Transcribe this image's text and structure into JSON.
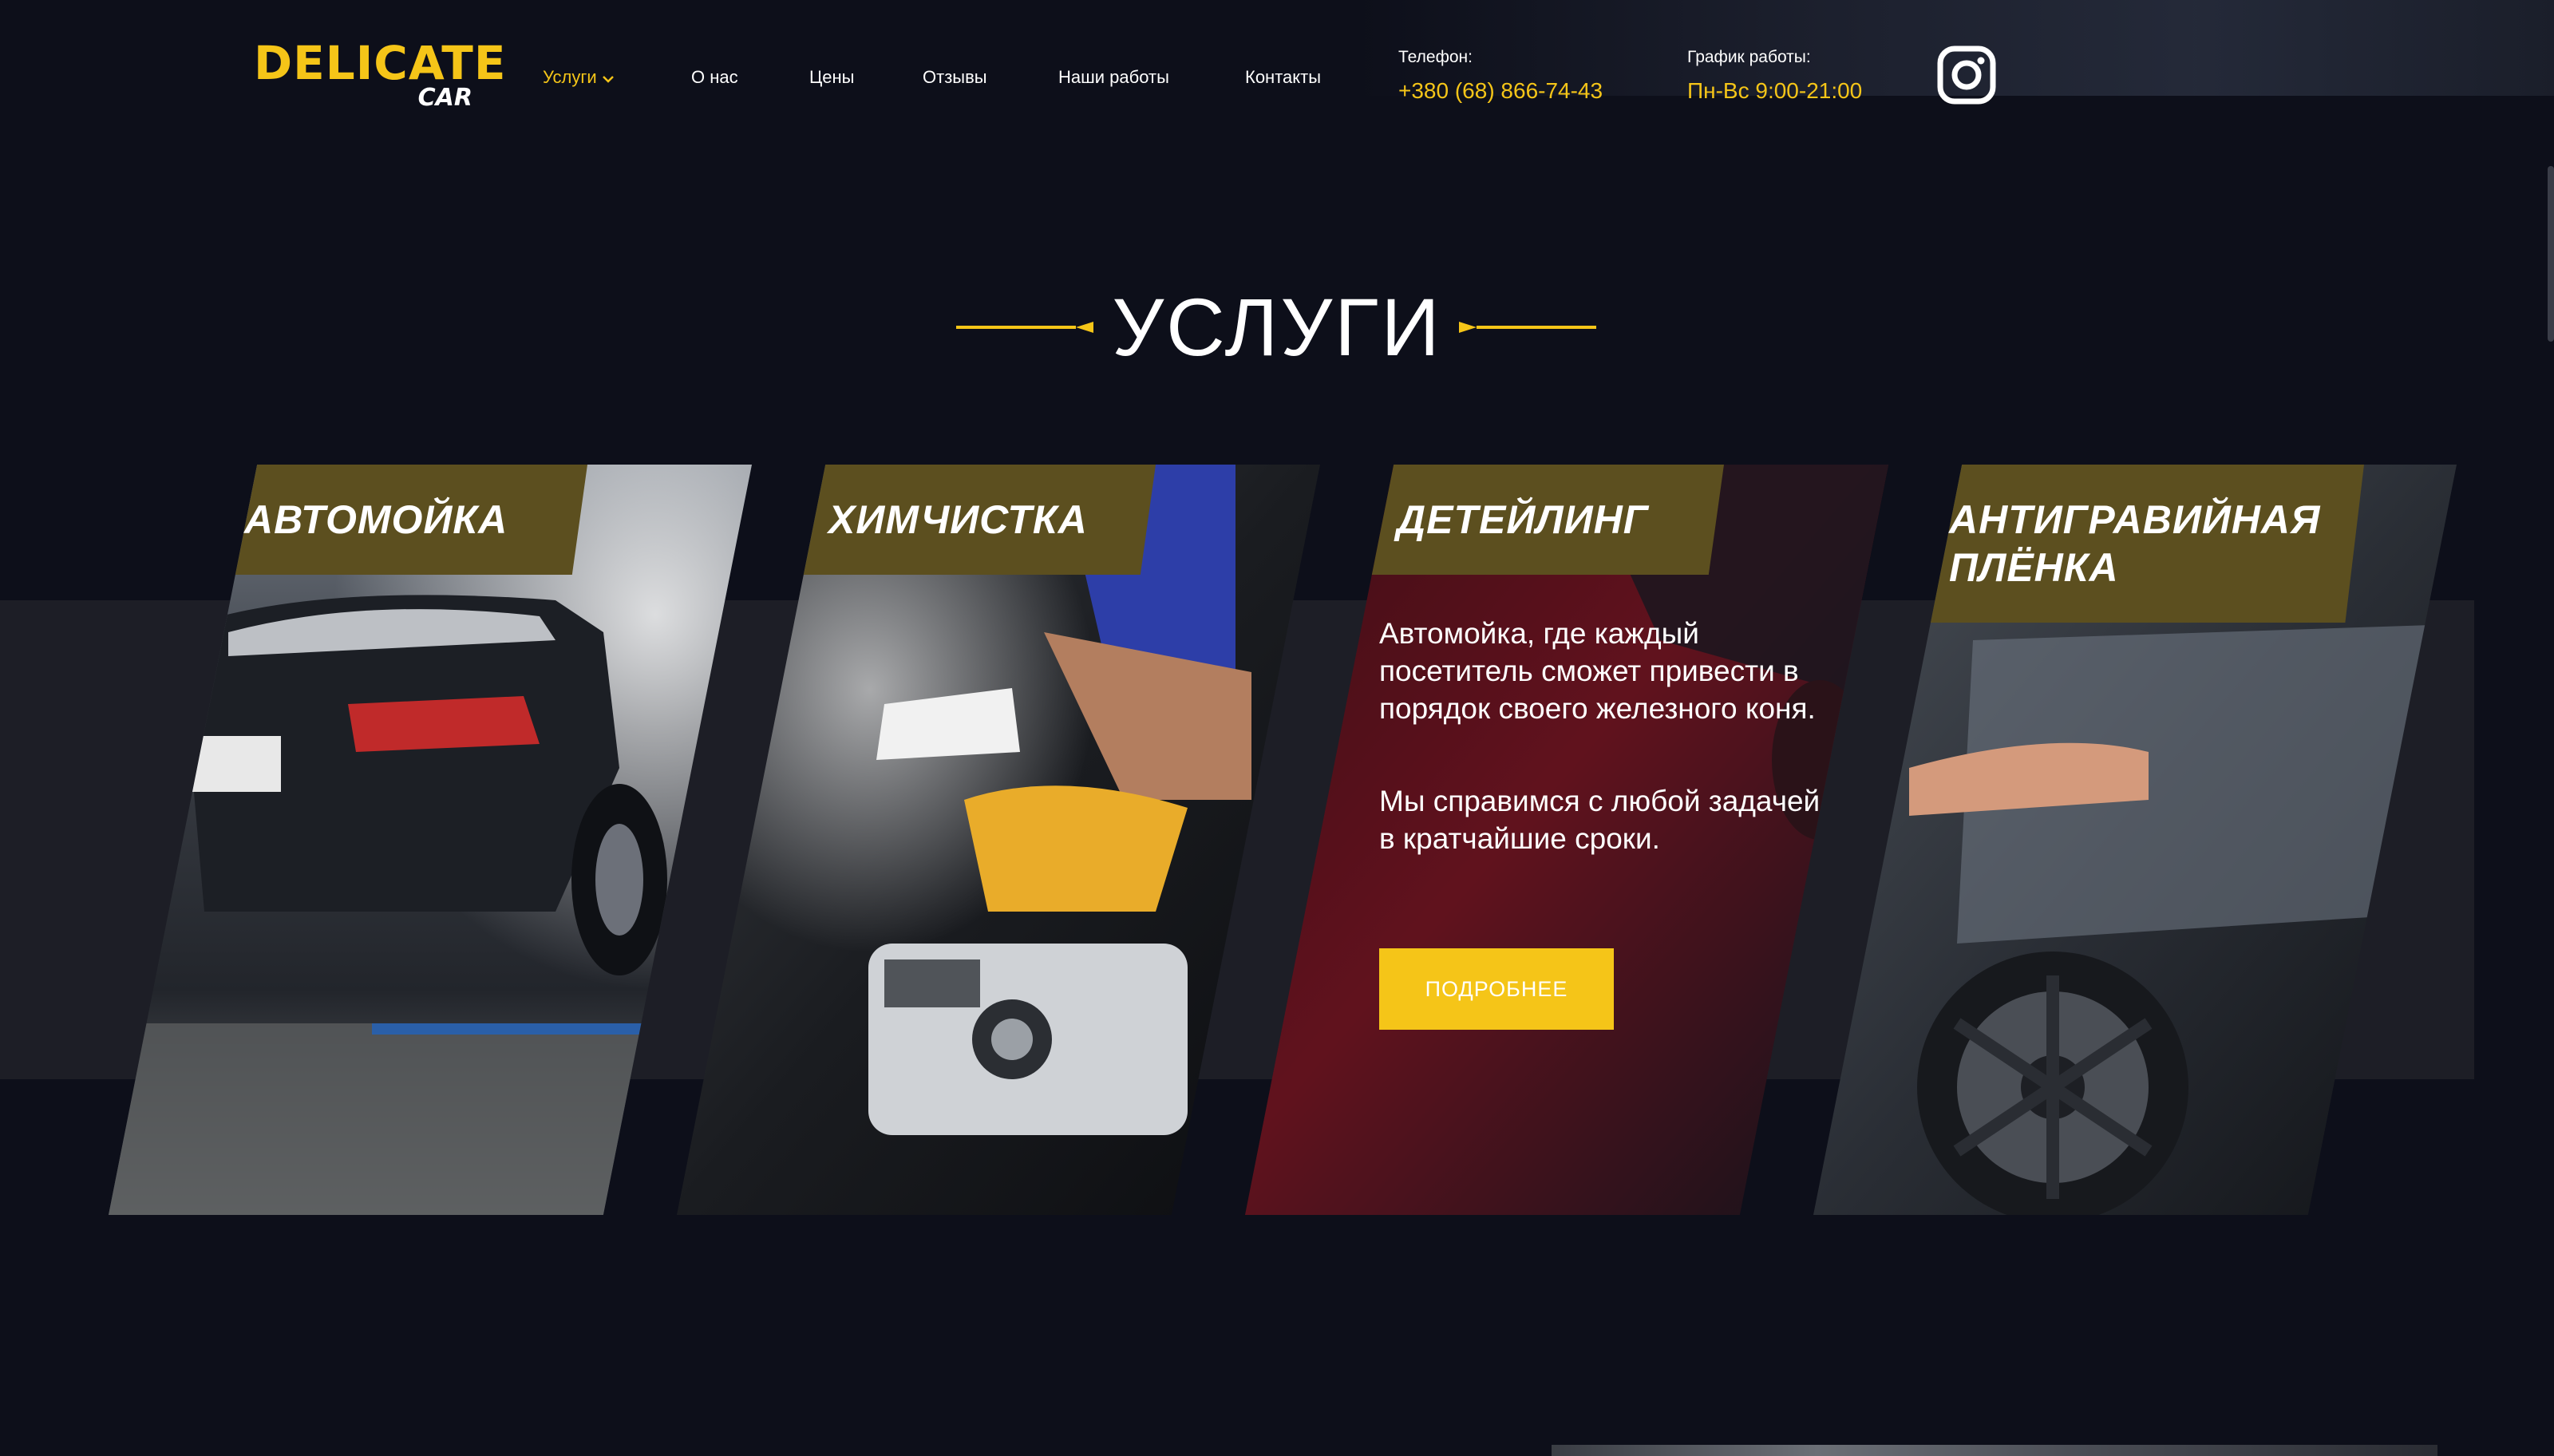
{
  "header": {
    "logo_main": "DELICATE",
    "logo_sub": "CAR",
    "nav": [
      {
        "label": "Услуги"
      },
      {
        "label": "О нас"
      },
      {
        "label": "Цены"
      },
      {
        "label": "Отзывы"
      },
      {
        "label": "Наши работы"
      },
      {
        "label": "Контакты"
      }
    ],
    "phone_label": "Телефон:",
    "phone": "+380 (68) 866-74-43",
    "hours_label": "График работы:",
    "hours": "Пн-Вс 9:00-21:00",
    "social_icon": "instagram-icon"
  },
  "section": {
    "title": "УСЛУГИ"
  },
  "cards": [
    {
      "title": "АВТОМОЙКА",
      "image": "car-wash-photo"
    },
    {
      "title": "ХИМЧИСТКА",
      "image": "interior-cleaning-photo"
    },
    {
      "title": "ДЕТЕЙЛИНГ",
      "image": "detailing-photo",
      "text1": "Автомойка, где каждый посетитель сможет привести в порядок своего железного коня.",
      "text2": "Мы справимся с любой задачей в кратчайшие сроки.",
      "button": "ПОДРОБНЕЕ"
    },
    {
      "title_line1": "АНТИГРАВИЙНАЯ",
      "title_line2": "ПЛЁНКА",
      "image": "protective-film-photo"
    }
  ],
  "colors": {
    "background": "#0d0f1a",
    "accent": "#f5c518",
    "label_bg": "#5c4f1f",
    "band": "#1d1e26"
  }
}
